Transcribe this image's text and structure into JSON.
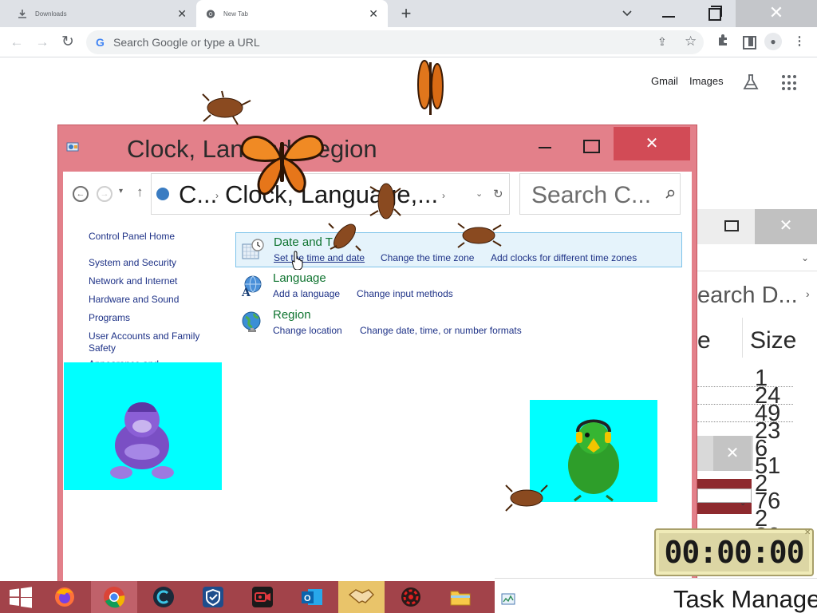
{
  "browser": {
    "tabs": [
      {
        "title": "Downloads",
        "icon": "download-icon"
      },
      {
        "title": "New Tab",
        "icon": "chrome-icon"
      }
    ],
    "omnibox_placeholder": "Search Google or type a URL",
    "ntp": {
      "gmail": "Gmail",
      "images": "Images"
    }
  },
  "control_panel": {
    "title": "Clock, Language, and Region",
    "title_visible": "Clock, Lan            and Region",
    "breadcrumb": [
      "C...",
      "Clock, Language,..."
    ],
    "search_placeholder": "Search C...",
    "nav": {
      "home": "Control Panel Home",
      "items": [
        "System and Security",
        "Network and Internet",
        "Hardware and Sound",
        "Programs",
        "User Accounts and Family Safety",
        "Appearance and"
      ]
    },
    "categories": [
      {
        "title": "Date and Time",
        "title_visible": "Date and T",
        "icon": "clock-calendar-icon",
        "links": [
          "Set the time and date",
          "Change the time zone",
          "Add clocks for different time zones"
        ]
      },
      {
        "title": "Language",
        "icon": "language-icon",
        "links": [
          "Add a language",
          "Change input methods"
        ]
      },
      {
        "title": "Region",
        "icon": "globe-icon",
        "links": [
          "Change location",
          "Change date, time, or number formats"
        ]
      }
    ]
  },
  "task_manager_bg": {
    "search_partial": "earch D...",
    "col_partial": "e",
    "col_size": "Size",
    "sizes": [
      "1",
      "24",
      "49",
      "23",
      "6",
      "51",
      "2",
      "76",
      "2",
      "30"
    ]
  },
  "timer": {
    "display": "00:00:00"
  },
  "taskbar": {
    "task_manager_label": "Task Manage",
    "apps": [
      "firefox-icon",
      "chrome-icon",
      "ccleaner-icon",
      "shield-icon",
      "screen-recorder-icon",
      "outlook-icon",
      "handshake-icon",
      "gear-red-icon",
      "file-explorer-icon"
    ]
  },
  "colors": {
    "accent": "#e3808a",
    "close": "#d24b56",
    "taskbar": "#a2434a",
    "link": "#1e3287",
    "category": "#0f7430",
    "pet_bg": "#00ffff"
  }
}
